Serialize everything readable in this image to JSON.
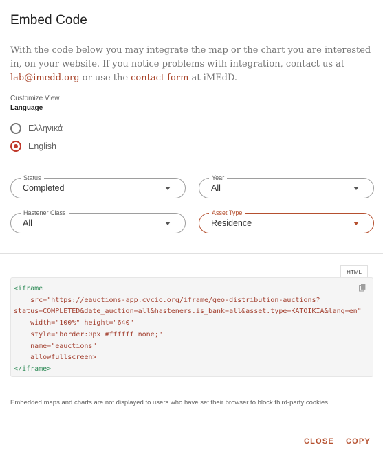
{
  "dialog": {
    "title": "Embed Code"
  },
  "intro": {
    "text_1": "With the code below you may integrate the map or the chart you are interested in, on your website. If you notice problems with integration, contact us at ",
    "email": "lab@imedd.org",
    "text_2": " or use the ",
    "contact_link": "contact form",
    "text_3": " at iMEdD."
  },
  "customize": {
    "section_label": "Customize View",
    "language_label": "Language",
    "options": [
      {
        "label": "Ελληνικά",
        "checked": false
      },
      {
        "label": "English",
        "checked": true
      }
    ]
  },
  "filters": {
    "status": {
      "label": "Status",
      "value": "Completed"
    },
    "year": {
      "label": "Year",
      "value": "All"
    },
    "hastener_class": {
      "label": "Hastener Class",
      "value": "All"
    },
    "asset_type": {
      "label": "Asset Type",
      "value": "Residence"
    }
  },
  "code": {
    "tab_label": "HTML",
    "open_tag": "<iframe",
    "src_attr": "src=",
    "src_value_1": "\"https://eauctions-app.cvcio.org/iframe/geo-distribution-auctions?",
    "src_value_2": "status=COMPLETED&date_auction=all&hasteners.is_bank=all&asset.type=KATOIKIA&lang=en\"",
    "size_line": "width=\"100%\" height=\"640\"",
    "style_line": "style=\"border:0px #ffffff none;\"",
    "name_line": "name=\"eauctions\"",
    "allow_line": "allowfullscreen>",
    "close_tag": "</iframe>"
  },
  "footnote": "Embedded maps and charts are not displayed to users who have set their browser to block third-party cookies.",
  "actions": {
    "close": "CLOSE",
    "copy": "COPY"
  },
  "colors": {
    "accent": "#b5502f",
    "radio_checked": "#c0392b",
    "code_tag": "#2e8b57",
    "code_text": "#a34030"
  },
  "icons": {
    "copy": "copy-icon",
    "dropdown": "chevron-down-icon"
  }
}
